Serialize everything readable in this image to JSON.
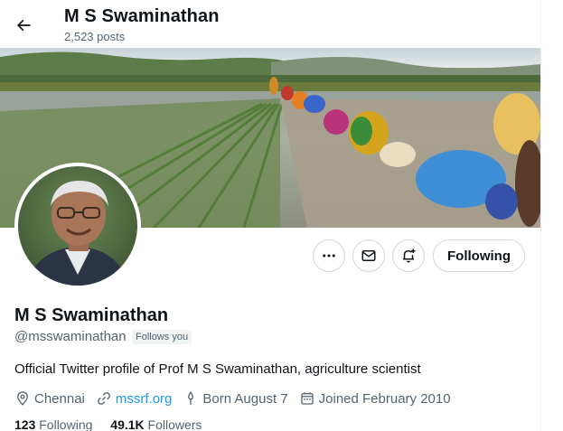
{
  "header": {
    "title": "M S Swaminathan",
    "posts_count": "2,523 posts"
  },
  "profile": {
    "name": "M S Swaminathan",
    "handle": "@msswaminathan",
    "follows_you": "Follows you",
    "bio": "Official Twitter profile of Prof M S Swaminathan, agriculture scientist",
    "location": "Chennai",
    "website": "mssrf.org",
    "born": "Born August 7",
    "joined": "Joined February 2010"
  },
  "actions": {
    "following_label": "Following"
  },
  "stats": {
    "following_count": "123",
    "following_label": "Following",
    "followers_count": "49.1K",
    "followers_label": "Followers"
  },
  "colors": {
    "accent": "#1d9bf0",
    "secondary_text": "#536471",
    "border": "#cfd9de"
  },
  "icons": [
    "back-arrow-icon",
    "more-icon",
    "message-icon",
    "notification-add-icon",
    "location-icon",
    "link-icon",
    "birthday-icon",
    "calendar-icon"
  ]
}
